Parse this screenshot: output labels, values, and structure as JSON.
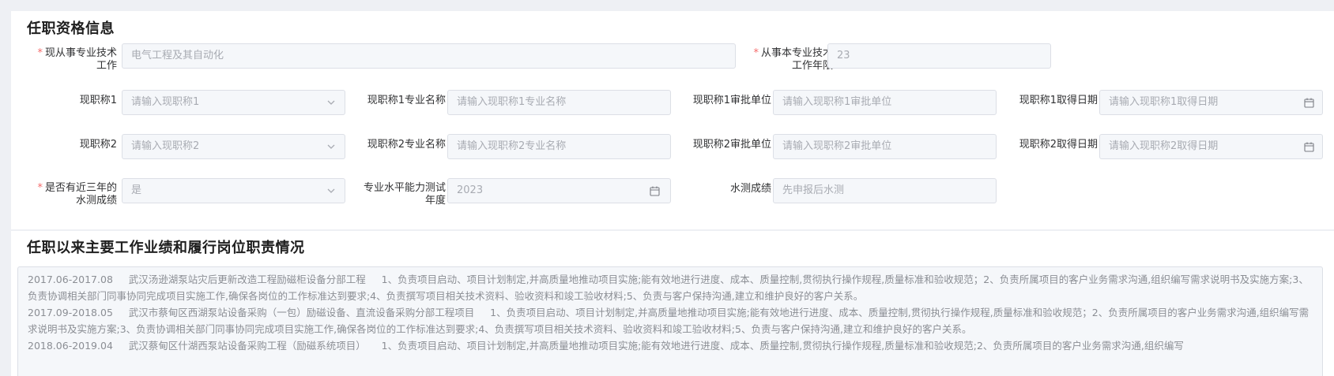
{
  "section1": {
    "title": "任职资格信息",
    "current_specialty": {
      "label_line1": "现从事专业技术",
      "label_line2": "工作",
      "value": "电气工程及其自动化"
    },
    "years": {
      "label_line1": "从事本专业技术",
      "label_line2": "工作年限",
      "value": "23"
    },
    "title1": {
      "label": "现职称1",
      "placeholder": "请输入现职称1",
      "major_label": "现职称1专业名称",
      "major_placeholder": "请输入现职称1专业名称",
      "unit_label": "现职称1审批单位",
      "unit_placeholder": "请输入现职称1审批单位",
      "date_label": "现职称1取得日期",
      "date_placeholder": "请输入现职称1取得日期"
    },
    "title2": {
      "label": "现职称2",
      "placeholder": "请输入现职称2",
      "major_label": "现职称2专业名称",
      "major_placeholder": "请输入现职称2专业名称",
      "unit_label": "现职称2审批单位",
      "unit_placeholder": "请输入现职称2审批单位",
      "date_label": "现职称2取得日期",
      "date_placeholder": "请输入现职称2取得日期"
    },
    "test": {
      "has_label_line1": "是否有近三年的",
      "has_label_line2": "水测成绩",
      "has_value": "是",
      "year_label_line1": "专业水平能力测试",
      "year_label_line2": "年度",
      "year_value": "2023",
      "score_label": "水测成绩",
      "score_value": "先申报后水测"
    }
  },
  "section2": {
    "title": "任职以来主要工作业绩和履行岗位职责情况",
    "entries": [
      {
        "period": "2017.06-2017.08",
        "project": "武汉汤逊湖泵站灾后更新改造工程励磁柜设备分部工程",
        "text": "1、负责项目启动、项目计划制定,并高质量地推动项目实施;能有效地进行进度、成本、质量控制,贯彻执行操作规程,质量标准和验收规范；2、负责所属项目的客户业务需求沟通,组织编写需求说明书及实施方案;3、负责协调相关部门同事协同完成项目实施工作,确保各岗位的工作标准达到要求;4、负责撰写项目相关技术资料、验收资料和竣工验收材料;5、负责与客户保持沟通,建立和维护良好的客户关系。"
      },
      {
        "period": "2017.09-2018.05",
        "project": "武汉市蔡甸区西湖泵站设备采购（一包）励磁设备、直流设备采购分部工程项目",
        "text": "1、负责项目启动、项目计划制定,并高质量地推动项目实施;能有效地进行进度、成本、质量控制,贯彻执行操作规程,质量标准和验收规范；2、负责所属项目的客户业务需求沟通,组织编写需求说明书及实施方案;3、负责协调相关部门同事协同完成项目实施工作,确保各岗位的工作标准达到要求;4、负责撰写项目相关技术资料、验收资料和竣工验收材料;5、负责与客户保持沟通,建立和维护良好的客户关系。"
      },
      {
        "period": "2018.06-2019.04",
        "project": "武汉蔡甸区什湖西泵站设备采购工程（励磁系统项目）",
        "text": "1、负责项目启动、项目计划制定,并高质量地推动项目实施;能有效地进行进度、成本、质量控制,贯彻执行操作规程,质量标准和验收规范;2、负责所属项目的客户业务需求沟通,组织编写"
      }
    ]
  },
  "icons": {
    "select": "chevron-down-icon",
    "date": "calendar-icon"
  },
  "colors": {
    "required": "#f56c6c",
    "field_bg": "#f5f7fa",
    "page_bg": "#eef0f4"
  }
}
